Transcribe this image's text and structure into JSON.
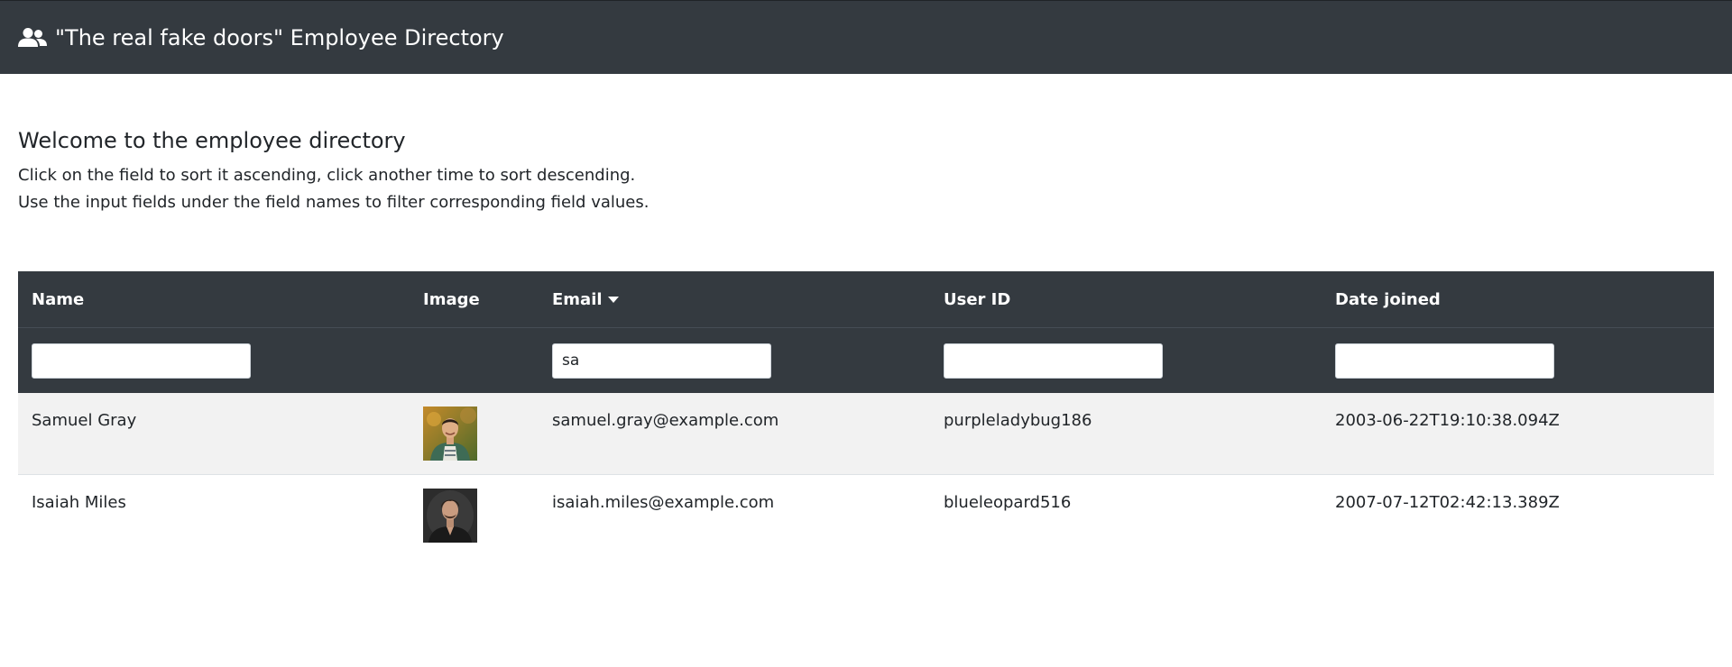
{
  "navbar": {
    "title": "\"The real fake doors\" Employee Directory",
    "icon": "users-icon"
  },
  "intro": {
    "heading": "Welcome to the employee directory",
    "line1": "Click on the field to sort it ascending, click another time to sort descending.",
    "line2": "Use the input fields under the field names to filter corresponding field values."
  },
  "table": {
    "columns": [
      {
        "label": "Name",
        "filter": ""
      },
      {
        "label": "Image"
      },
      {
        "label": "Email",
        "filter": "sa",
        "sorted": "descending"
      },
      {
        "label": "User ID",
        "filter": ""
      },
      {
        "label": "Date joined",
        "filter": ""
      }
    ],
    "rows": [
      {
        "name": "Samuel Gray",
        "email": "samuel.gray@example.com",
        "user_id": "purpleladybug186",
        "date_joined": "2003-06-22T19:10:38.094Z"
      },
      {
        "name": "Isaiah Miles",
        "email": "isaiah.miles@example.com",
        "user_id": "blueleopard516",
        "date_joined": "2007-07-12T02:42:13.389Z"
      }
    ]
  },
  "colors": {
    "header_bg": "#343a40",
    "stripe": "#f2f2f2"
  }
}
